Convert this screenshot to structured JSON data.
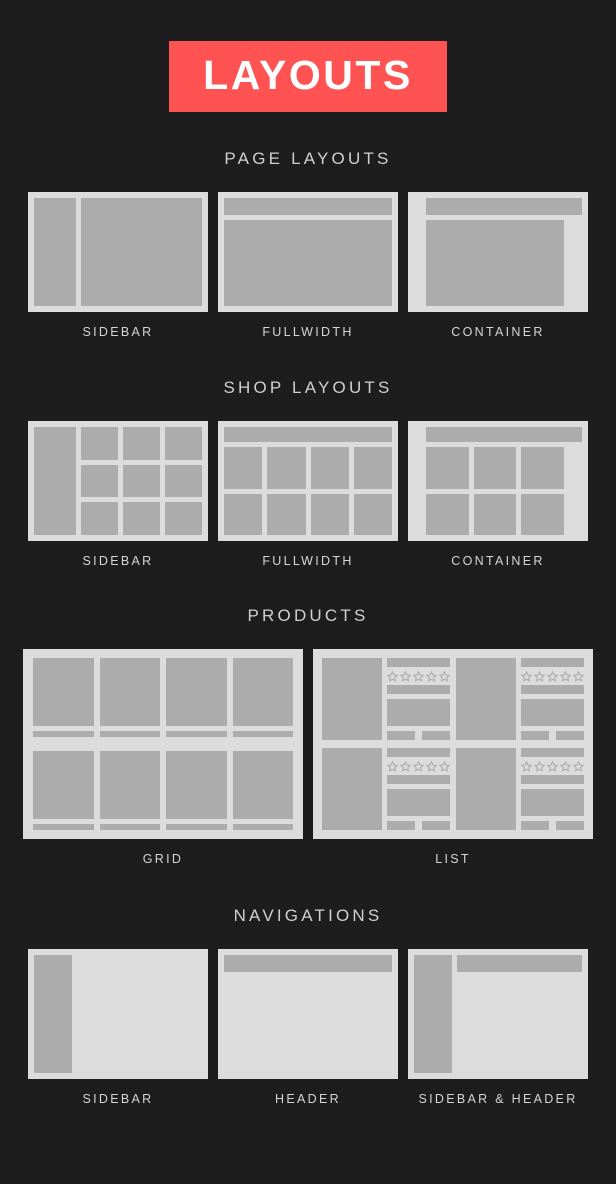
{
  "theme": {
    "background": "#1d1d1d",
    "accent": "#ff5252",
    "frame": "#dcdcdc",
    "block": "#acacac",
    "text": "#d5d5d5"
  },
  "banner": {
    "title": "LAYOUTS"
  },
  "sections": [
    {
      "heading": "PAGE LAYOUTS",
      "items": [
        {
          "caption": "SIDEBAR"
        },
        {
          "caption": "FULLWIDTH"
        },
        {
          "caption": "CONTAINER"
        }
      ]
    },
    {
      "heading": "SHOP LAYOUTS",
      "items": [
        {
          "caption": "SIDEBAR"
        },
        {
          "caption": "FULLWIDTH"
        },
        {
          "caption": "CONTAINER"
        }
      ]
    },
    {
      "heading": "PRODUCTS",
      "items": [
        {
          "caption": "GRID"
        },
        {
          "caption": "LIST"
        }
      ]
    },
    {
      "heading": "NAVIGATIONS",
      "items": [
        {
          "caption": "SIDEBAR"
        },
        {
          "caption": "HEADER"
        },
        {
          "caption": "SIDEBAR & HEADER"
        }
      ]
    }
  ],
  "icons": {
    "rating_star": "star-outline-icon",
    "rating_count": 5
  }
}
